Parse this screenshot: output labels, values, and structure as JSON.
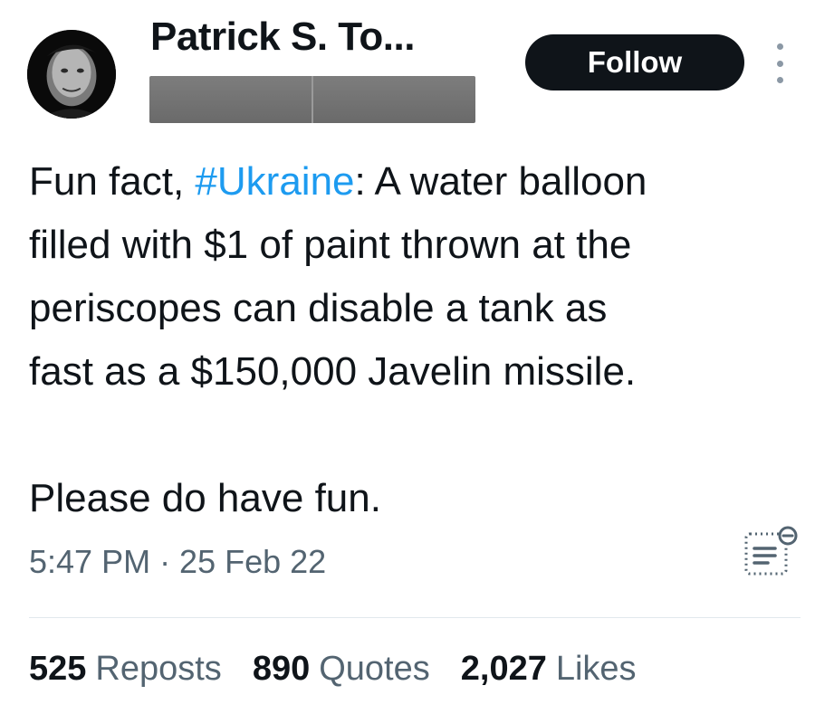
{
  "author": {
    "display_name": "Patrick S. To...",
    "handle": ""
  },
  "follow_button": {
    "label": "Follow"
  },
  "tweet": {
    "line1_before": "Fun fact, ",
    "hashtag": "#Ukraine",
    "line1_after": ": A water balloon",
    "line2": "filled with $1 of paint thrown at the",
    "line3": "periscopes can disable a tank as",
    "line4": "fast as a $150,000 Javelin missile.",
    "line5": "Please do have fun."
  },
  "timestamp": "5:47 PM · 25 Feb 22",
  "stats": {
    "reposts": {
      "count": "525",
      "label": "Reposts"
    },
    "quotes": {
      "count": "890",
      "label": "Quotes"
    },
    "likes": {
      "count": "2,027",
      "label": "Likes"
    }
  },
  "colors": {
    "hashtag": "#1d9bf0",
    "secondary_text": "#536471",
    "follow_bg": "#0f1419"
  },
  "icons": {
    "more": "more-vertical-icon",
    "translate": "translate-icon"
  }
}
